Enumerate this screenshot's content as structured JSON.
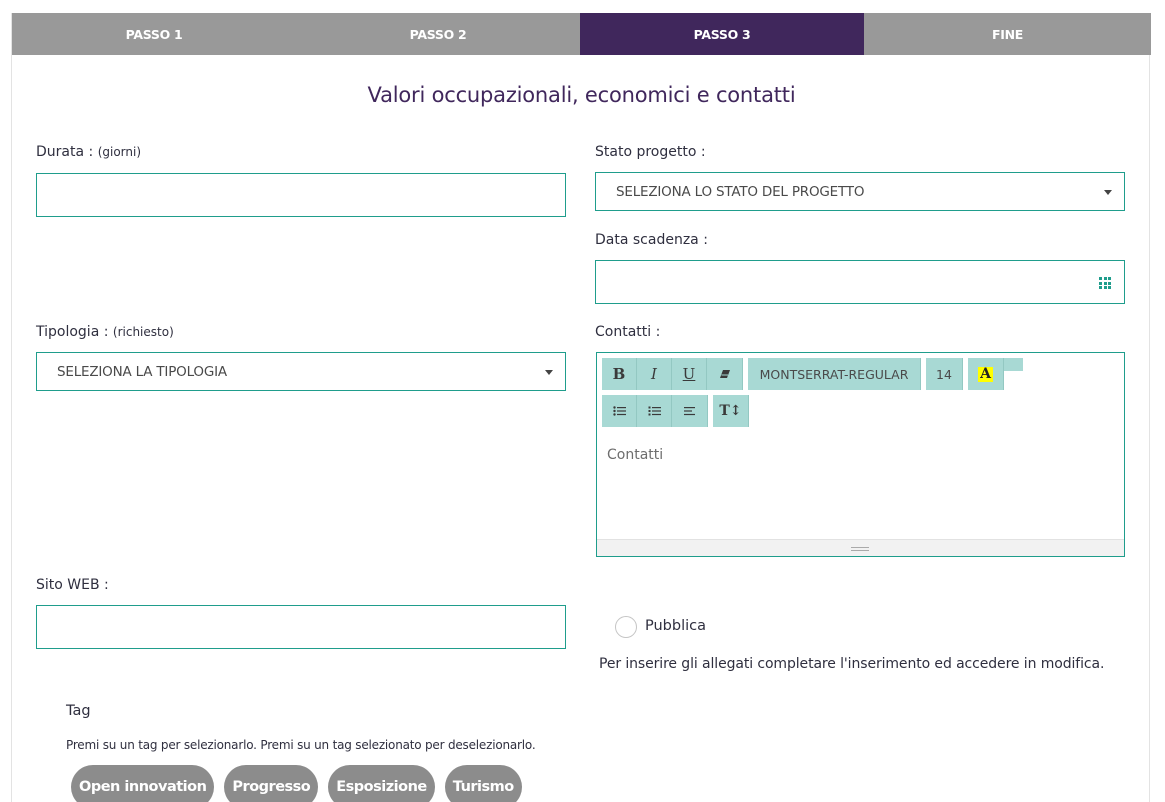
{
  "steps": [
    {
      "label": "PASSO 1",
      "active": false
    },
    {
      "label": "PASSO 2",
      "active": false
    },
    {
      "label": "PASSO 3",
      "active": true
    },
    {
      "label": "FINE",
      "active": false
    }
  ],
  "page_title": "Valori occupazionali, economici e contatti",
  "fields": {
    "durata": {
      "label": "Durata :",
      "hint": "(giorni)",
      "value": ""
    },
    "stato": {
      "label": "Stato progetto :",
      "selected": "SELEZIONA LO STATO DEL PROGETTO"
    },
    "scadenza": {
      "label": "Data scadenza :",
      "value": ""
    },
    "tipologia": {
      "label": "Tipologia :",
      "hint": "(richiesto)",
      "selected": "SELEZIONA LA TIPOLOGIA"
    },
    "contatti": {
      "label": "Contatti :",
      "placeholder": "Contatti",
      "toolbar": {
        "bold": "B",
        "italic": "I",
        "underline": "U",
        "font": "MONTSERRAT-REGULAR",
        "size": "14",
        "color": "A",
        "height": "T↕"
      }
    },
    "sito": {
      "label": "Sito WEB :",
      "value": ""
    }
  },
  "pubblica_label": "Pubblica",
  "allegati_note": "Per inserire gli allegati completare l'inserimento ed accedere in modifica.",
  "tags": {
    "title": "Tag",
    "help": "Premi su un tag per selezionarlo. Premi su un tag selezionato per deselezionarlo.",
    "items": [
      "Open innovation",
      "Progresso",
      "Esposizione",
      "Turismo"
    ]
  },
  "colors": {
    "active_step": "#40275c",
    "step_bg": "#999999",
    "accent": "#1f9d8c",
    "toolbar": "#a8d9d4",
    "tag_bg": "#8c8c8c"
  },
  "icons": [
    "caret-down-icon",
    "calendar-grid-icon",
    "eraser-icon",
    "bullet-list-icon",
    "numbered-list-icon",
    "align-icon",
    "resize-handle-icon"
  ]
}
